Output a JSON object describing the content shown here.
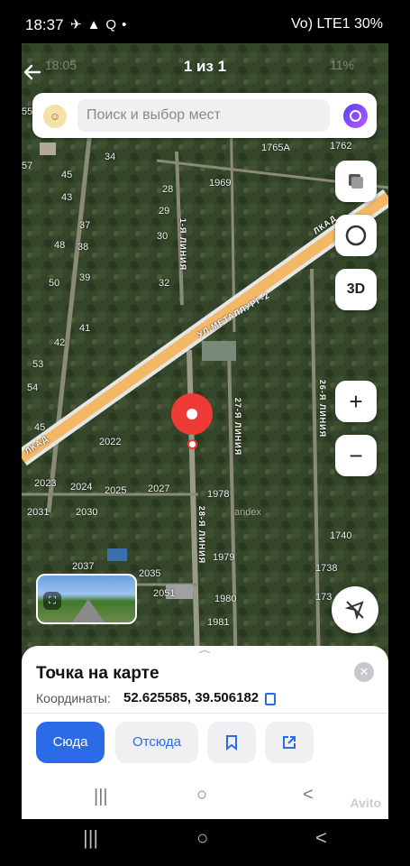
{
  "status": {
    "time": "18:37",
    "right": "Vo) LTE1 30%",
    "battery": "30%"
  },
  "viewer": {
    "counter": "1 из 1"
  },
  "inner_status": {
    "time": "18:05",
    "battery": "11%"
  },
  "search": {
    "placeholder": "Поиск и выбор мест",
    "avatar_icon": "user-avatar-icon"
  },
  "map": {
    "controls": {
      "layers_icon": "layers-icon",
      "compass_icon": "compass-icon",
      "btn_3d": "3D",
      "zoom_in": "+",
      "zoom_out": "−",
      "location_icon": "location-off-icon"
    },
    "labels": {
      "n55": "55",
      "n57": "57",
      "n45": "45",
      "n34": "34",
      "n43": "43",
      "n37": "37",
      "n48": "48",
      "n38": "38",
      "n50": "50",
      "n39": "39",
      "n41": "41",
      "n42": "42",
      "n53": "53",
      "n54": "54",
      "n45b": "45",
      "n28": "28",
      "n29": "29",
      "n30": "30",
      "n32": "32",
      "n1969": "1969",
      "n1765a": "1765А",
      "n1762": "1762",
      "n2022": "2022",
      "n2023": "2023",
      "n2024": "2024",
      "n2025": "2025",
      "n2027": "2027",
      "n2031": "2031",
      "n2030": "2030",
      "n1978": "1978",
      "n1979": "1979",
      "n1980": "1980",
      "n1981": "1981",
      "n2037": "2037",
      "n2035": "2035",
      "n2051": "2051",
      "n1740": "1740",
      "n1738": "1738",
      "n173": "173",
      "yandex": "andex"
    },
    "roads": {
      "lkad": "ЛКАД",
      "lkad2": "ЛКАД",
      "metallurg": "УЛ.МЕТАЛЛУРГ-2",
      "line1": "1-Я ЛИНИЯ",
      "line27": "27-Я ЛИНИЯ",
      "line28": "28-Я ЛИНИЯ",
      "line26": "26-Я ЛИНИЯ"
    }
  },
  "sheet": {
    "title": "Точка на карте",
    "coords_label": "Координаты:",
    "coords": "52.625585, 39.506182",
    "btn_here": "Сюда",
    "btn_from": "Отсюда",
    "bookmark_icon": "bookmark-icon",
    "share_icon": "share-icon",
    "close_icon": "close-icon"
  },
  "watermark": "Avito",
  "nav": {
    "recents": "|||",
    "home": "○",
    "back": "<"
  }
}
